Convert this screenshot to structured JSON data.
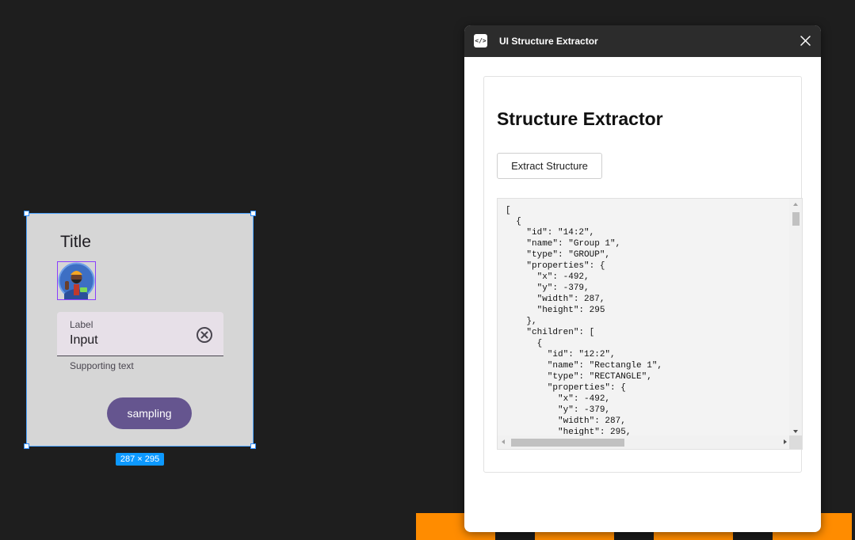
{
  "colors": {
    "canvas_bg": "#1e1e1e",
    "frame_bg": "#d6d6d6",
    "selection": "#4aa3ff",
    "button_primary": "#65558f",
    "badge": "#0d99ff",
    "stripe_orange": "#ff8c00",
    "stripe_dark": "#1a1a1a"
  },
  "stripes": [
    "#ff8c00",
    "#1a1a1a",
    "#ff8c00",
    "#1a1a1a",
    "#ff8c00",
    "#1a1a1a",
    "#ff8c00"
  ],
  "frame": {
    "title": "Title",
    "avatar_icon": "avatar-illustration-icon",
    "text_field": {
      "label": "Label",
      "value": "Input",
      "clear_icon": "cancel-circle-icon",
      "supporting_text": "Supporting text"
    },
    "button_label": "sampling",
    "dimension_badge": "287 × 295"
  },
  "plugin": {
    "window_title": "UI Structure Extractor",
    "icon": "code-icon",
    "close_icon": "close-icon",
    "heading": "Structure Extractor",
    "extract_button": "Extract Structure",
    "output": "[\n  {\n    \"id\": \"14:2\",\n    \"name\": \"Group 1\",\n    \"type\": \"GROUP\",\n    \"properties\": {\n      \"x\": -492,\n      \"y\": -379,\n      \"width\": 287,\n      \"height\": 295\n    },\n    \"children\": [\n      {\n        \"id\": \"12:2\",\n        \"name\": \"Rectangle 1\",\n        \"type\": \"RECTANGLE\",\n        \"properties\": {\n          \"x\": -492,\n          \"y\": -379,\n          \"width\": 287,\n          \"height\": 295,"
  }
}
